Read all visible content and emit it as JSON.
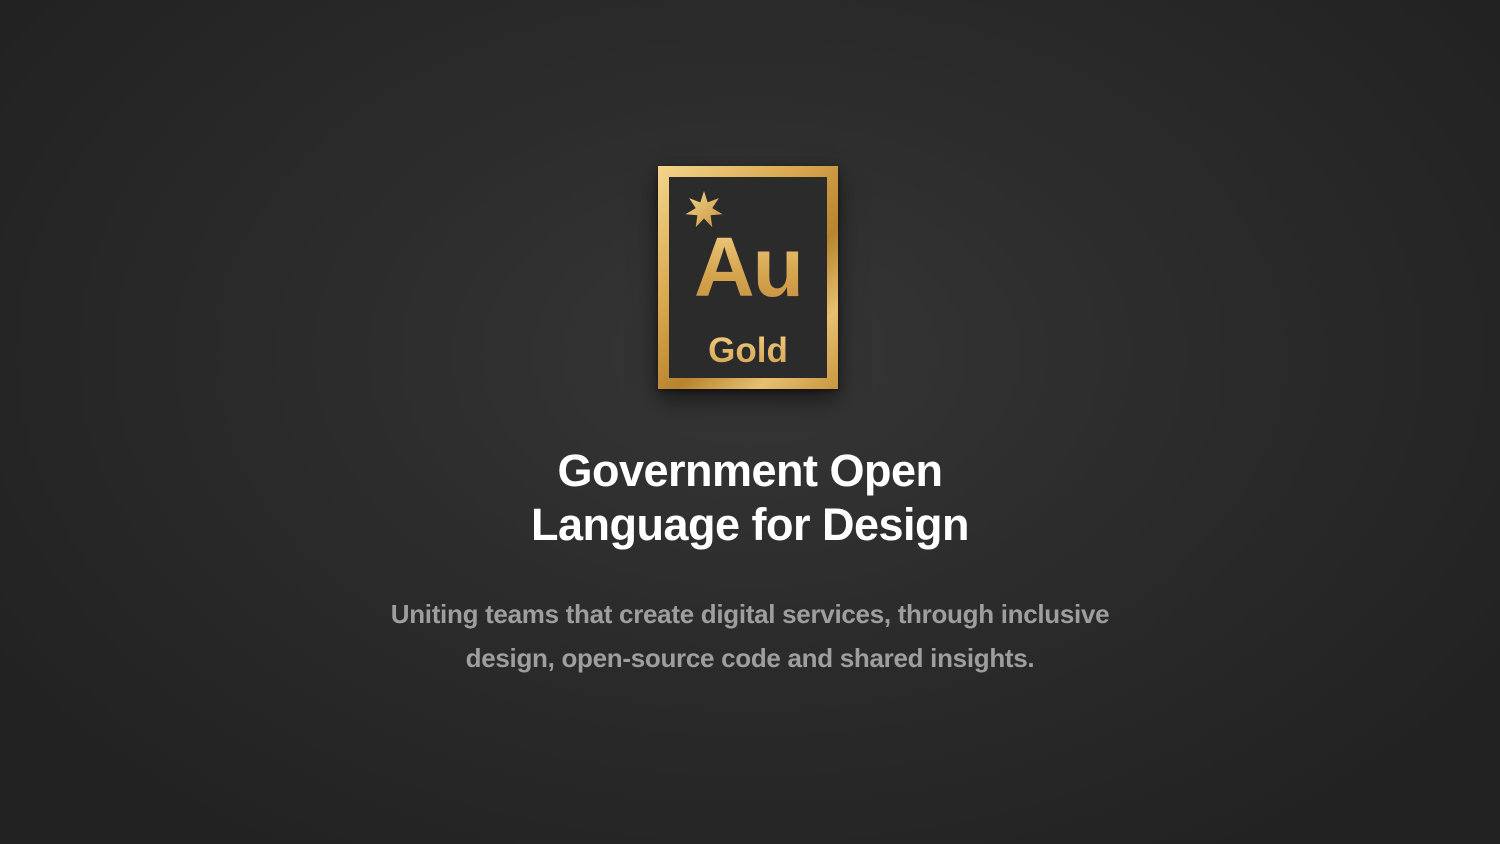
{
  "logo": {
    "symbol": "Au",
    "name": "Gold",
    "icon": "seven-pointed-star-icon",
    "gold_color": "#d9a84f",
    "tile_color": "#2b2b2b"
  },
  "headline": {
    "line1": "Government Open",
    "line2": "Language for Design"
  },
  "tagline": {
    "line1": "Uniting teams that create digital services, through inclusive",
    "line2": "design, open-source code and shared insights."
  },
  "colors": {
    "background": "#2c2c2c",
    "headline": "#ffffff",
    "tagline": "#9e9e9e"
  }
}
